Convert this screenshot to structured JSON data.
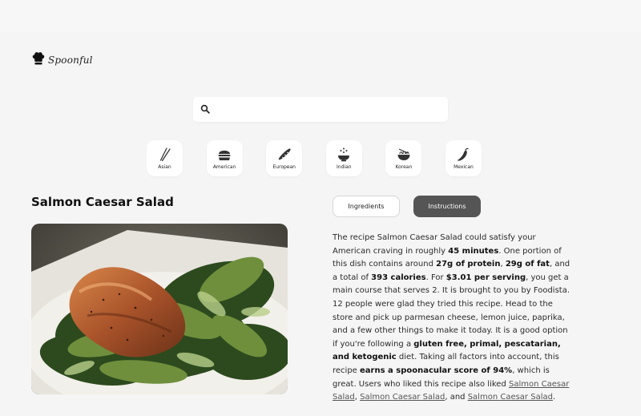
{
  "brand": {
    "name": "Spoonful"
  },
  "search": {
    "value": "",
    "placeholder": ""
  },
  "cuisines": [
    {
      "label": "Asian",
      "icon": "chopsticks-icon"
    },
    {
      "label": "American",
      "icon": "burger-icon"
    },
    {
      "label": "European",
      "icon": "baguette-icon"
    },
    {
      "label": "Indian",
      "icon": "curry-icon"
    },
    {
      "label": "Korean",
      "icon": "noodle-bowl-icon"
    },
    {
      "label": "Mexican",
      "icon": "chili-pepper-icon"
    }
  ],
  "recipe": {
    "title": "Salmon Caesar Salad",
    "tabs": {
      "ingredients": "Ingredients",
      "instructions": "Instructions",
      "active": "instructions"
    },
    "summary": {
      "t1": "The recipe Salmon Caesar Salad could satisfy your American craving in roughly ",
      "time": "45 minutes",
      "t2": ". One portion of this dish contains around ",
      "protein": "27g of protein",
      "t3": ", ",
      "fat": "29g of fat",
      "t4": ", and a total of ",
      "calories": "393 calories",
      "t5": ". For ",
      "price": "$3.01 per serving",
      "t6": ", you get a main course that serves 2. It is brought to you by Foodista. 12 people were glad they tried this recipe. Head to the store and pick up parmesan cheese, lemon juice, paprika, and a few other things to make it today. It is a good option if you're following a ",
      "diets": "gluten free, primal, pescatarian, and ketogenic",
      "t7": " diet. Taking all factors into account, this recipe ",
      "score": "earns a spoonacular score of 94%",
      "t8": ", which is great. Users who liked this recipe also liked ",
      "link1": "Salmon Caesar Salad",
      "t9": ", ",
      "link2": "Salmon Caesar Salad",
      "t10": ", and ",
      "link3": "Salmon Caesar Salad",
      "t11": "."
    }
  },
  "colors": {
    "background": "#f5f5f5",
    "activeTab": "#555555",
    "card": "#ffffff"
  }
}
